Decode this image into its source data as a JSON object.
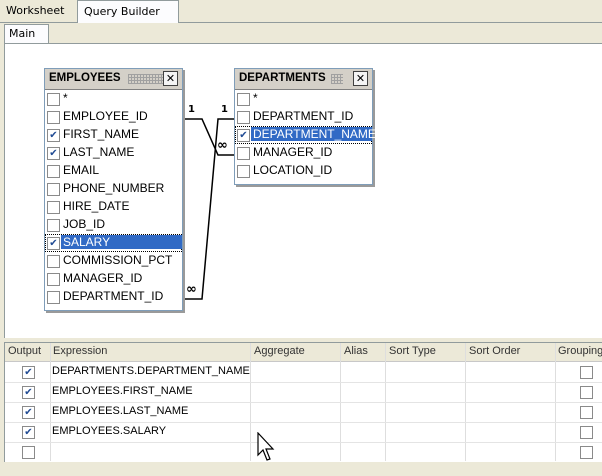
{
  "tabs": [
    {
      "label": "Worksheet"
    },
    {
      "label": "Query Builder"
    }
  ],
  "subtab": {
    "label": "Main"
  },
  "employees": {
    "title": "EMPLOYEES",
    "fields": [
      {
        "label": "*",
        "checked": false
      },
      {
        "label": "EMPLOYEE_ID",
        "checked": false
      },
      {
        "label": "FIRST_NAME",
        "checked": true
      },
      {
        "label": "LAST_NAME",
        "checked": true
      },
      {
        "label": "EMAIL",
        "checked": false
      },
      {
        "label": "PHONE_NUMBER",
        "checked": false
      },
      {
        "label": "HIRE_DATE",
        "checked": false
      },
      {
        "label": "JOB_ID",
        "checked": false
      },
      {
        "label": "SALARY",
        "checked": true
      },
      {
        "label": "COMMISSION_PCT",
        "checked": false
      },
      {
        "label": "MANAGER_ID",
        "checked": false
      },
      {
        "label": "DEPARTMENT_ID",
        "checked": false
      }
    ]
  },
  "departments": {
    "title": "DEPARTMENTS",
    "fields": [
      {
        "label": "*",
        "checked": false
      },
      {
        "label": "DEPARTMENT_ID",
        "checked": false
      },
      {
        "label": "DEPARTMENT_NAME",
        "checked": true
      },
      {
        "label": "MANAGER_ID",
        "checked": false
      },
      {
        "label": "LOCATION_ID",
        "checked": false
      }
    ]
  },
  "joins": {
    "emp_side_top": "1",
    "dept_side_top": "1",
    "dept_side_bottom": "∞",
    "emp_side_bottom": "∞"
  },
  "grid": {
    "columns": [
      "Output",
      "Expression",
      "Aggregate",
      "Alias",
      "Sort Type",
      "Sort Order",
      "Grouping"
    ],
    "rows": [
      {
        "output": true,
        "expression": "DEPARTMENTS.DEPARTMENT_NAME"
      },
      {
        "output": true,
        "expression": "EMPLOYEES.FIRST_NAME"
      },
      {
        "output": true,
        "expression": "EMPLOYEES.LAST_NAME"
      },
      {
        "output": true,
        "expression": "EMPLOYEES.SALARY"
      },
      {
        "output": false,
        "expression": ""
      }
    ]
  },
  "check_glyph": "✔",
  "close_glyph": "✕"
}
